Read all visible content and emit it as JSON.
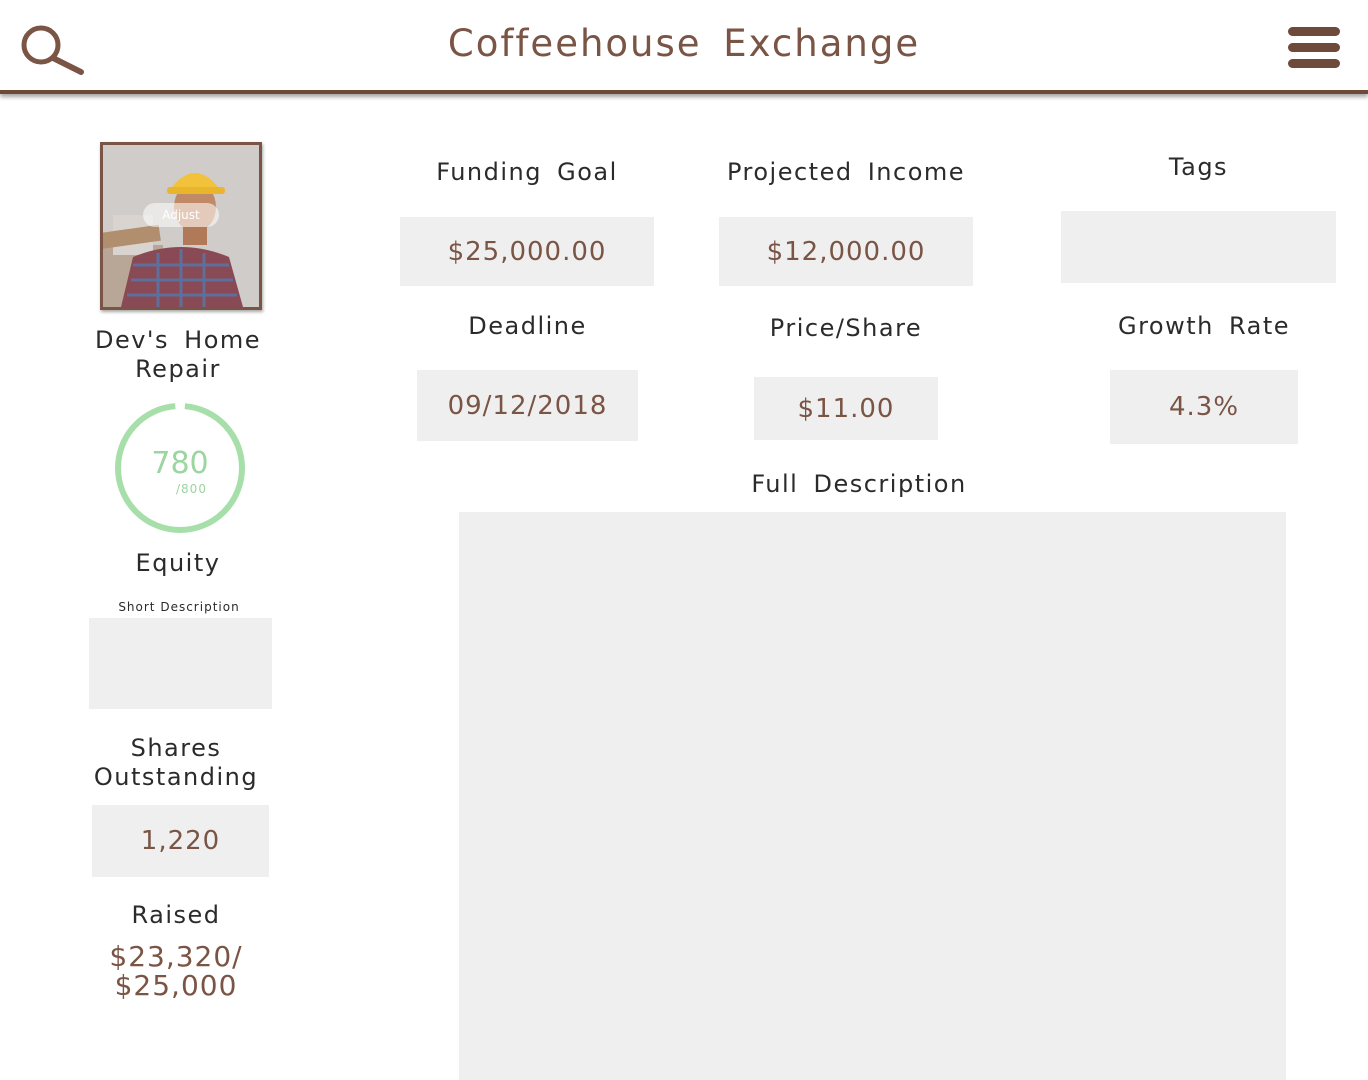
{
  "header": {
    "title": "Coffeehouse Exchange"
  },
  "icons": {
    "search": "search-icon",
    "menu": "hamburger-menu-icon"
  },
  "profile": {
    "name": "Dev's Home Repair",
    "adjust_label": "Adjust",
    "score_value": "780",
    "score_max": "/800",
    "score_fraction": 0.975,
    "type_label": "Equity",
    "short_description_label": "Short Description",
    "short_description_value": "",
    "shares_label": "Shares Outstanding",
    "shares_value": "1,220",
    "raised_label": "Raised",
    "raised_current": "$23,320/",
    "raised_goal": "$25,000"
  },
  "fields": {
    "funding_goal": {
      "label": "Funding Goal",
      "value": "$25,000.00"
    },
    "projected_income": {
      "label": "Projected Income",
      "value": "$12,000.00"
    },
    "tags": {
      "label": "Tags",
      "value": ""
    },
    "deadline": {
      "label": "Deadline",
      "value": "09/12/2018"
    },
    "price_share": {
      "label": "Price/Share",
      "value": "$11.00"
    },
    "growth_rate": {
      "label": "Growth Rate",
      "value": "4.3%"
    },
    "full_description": {
      "label": "Full Description",
      "value": ""
    }
  },
  "colors": {
    "accent": "#7a5444",
    "field_bg": "#efefef",
    "score_ring": "#a6dfa9"
  }
}
